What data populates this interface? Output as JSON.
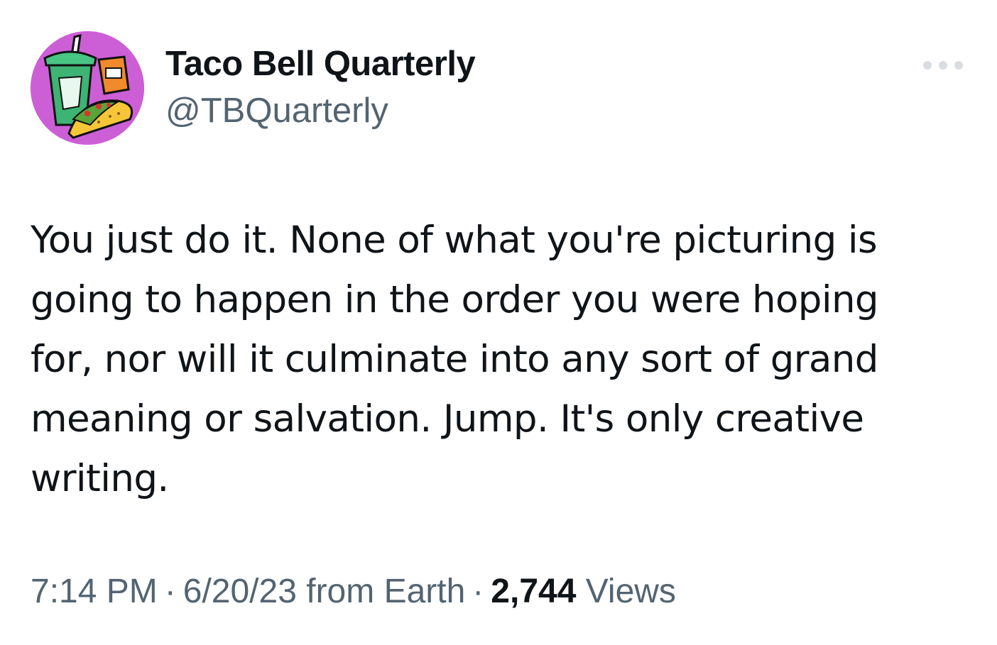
{
  "author": {
    "display_name": "Taco Bell Quarterly",
    "handle": "@TBQuarterly",
    "avatar_icon": "taco-drink-illustration-icon",
    "avatar_bg": "#cc5fd6"
  },
  "menu": {
    "icon": "more-options-icon"
  },
  "tweet": {
    "text": "You just do it. None of what you're picturing is going to happen in the order you were hoping for, nor will it culminate into any sort of grand meaning or salvation. Jump. It's only creative writing."
  },
  "meta": {
    "time": "7:14 PM",
    "separator": "·",
    "date_source": "6/20/23 from Earth",
    "views_count": "2,744",
    "views_label": "Views"
  },
  "colors": {
    "text_primary": "#0f1419",
    "text_secondary": "#536471",
    "menu_dots": "#d9dde1"
  }
}
